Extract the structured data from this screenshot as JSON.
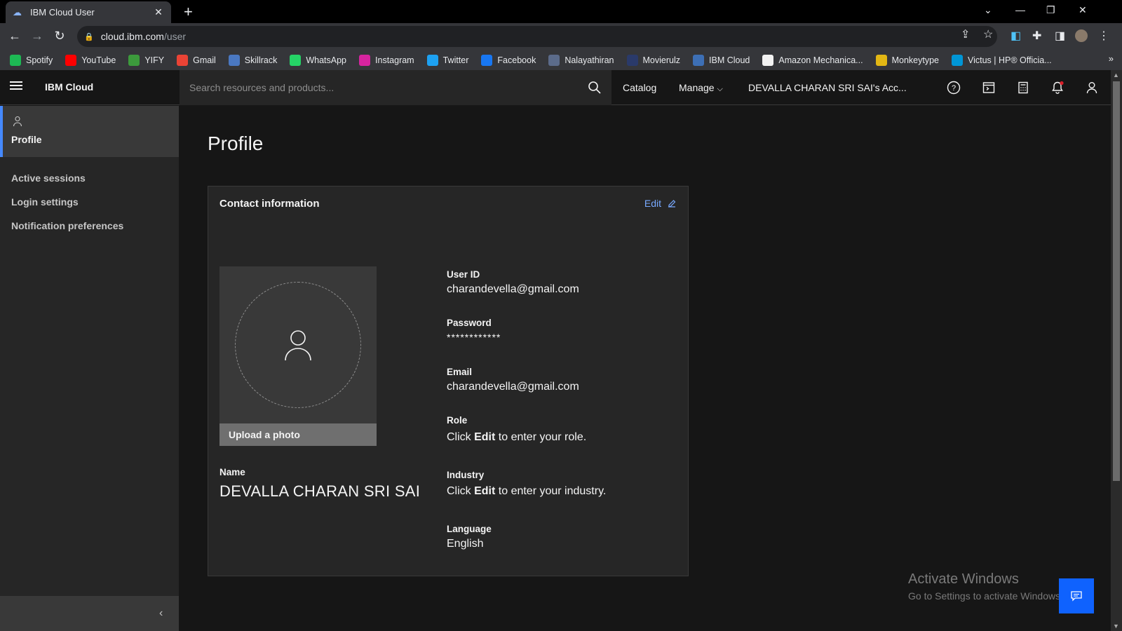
{
  "browser": {
    "tab_title": "IBM Cloud User",
    "url_host": "cloud.ibm.com",
    "url_path": "/user",
    "bookmarks": [
      {
        "label": "Spotify",
        "icon": "spotify-icon",
        "color": "#1db954"
      },
      {
        "label": "YouTube",
        "icon": "youtube-icon",
        "color": "#ff0000"
      },
      {
        "label": "YIFY",
        "icon": "yify-icon",
        "color": "#3c9a3c"
      },
      {
        "label": "Gmail",
        "icon": "gmail-icon",
        "color": "#ea4335"
      },
      {
        "label": "Skillrack",
        "icon": "skillrack-icon",
        "color": "#4a78c2"
      },
      {
        "label": "WhatsApp",
        "icon": "whatsapp-icon",
        "color": "#25d366"
      },
      {
        "label": "Instagram",
        "icon": "instagram-icon",
        "color": "#d6249f"
      },
      {
        "label": "Twitter",
        "icon": "twitter-icon",
        "color": "#1da1f2"
      },
      {
        "label": "Facebook",
        "icon": "facebook-icon",
        "color": "#1877f2"
      },
      {
        "label": "Nalayathiran",
        "icon": "nalayathiran-icon",
        "color": "#5b6b8a"
      },
      {
        "label": "Movierulz",
        "icon": "movierulz-icon",
        "color": "#2a3a6a"
      },
      {
        "label": "IBM Cloud",
        "icon": "ibm-cloud-icon",
        "color": "#3d6fb5"
      },
      {
        "label": "Amazon Mechanica...",
        "icon": "amazon-icon",
        "color": "#f2f2f2"
      },
      {
        "label": "Monkeytype",
        "icon": "monkeytype-icon",
        "color": "#e2b714"
      },
      {
        "label": "Victus | HP® Officia...",
        "icon": "hp-icon",
        "color": "#0096d6"
      }
    ]
  },
  "header": {
    "brand": "IBM Cloud",
    "search_placeholder": "Search resources and products...",
    "catalog": "Catalog",
    "manage": "Manage",
    "account": "DEVALLA CHARAN SRI SAI's Acc..."
  },
  "sidebar": {
    "active": "Profile",
    "items": [
      "Active sessions",
      "Login settings",
      "Notification preferences"
    ]
  },
  "main": {
    "title": "Profile",
    "card_title": "Contact information",
    "edit_label": "Edit",
    "upload_label": "Upload a photo",
    "name_label": "Name",
    "name_value": "DEVALLA CHARAN SRI SAI",
    "user_id_label": "User ID",
    "user_id_value": "charandevella@gmail.com",
    "password_label": "Password",
    "password_value": "************",
    "email_label": "Email",
    "email_value": "charandevella@gmail.com",
    "role_label": "Role",
    "role_prefix": "Click ",
    "role_bold": "Edit",
    "role_suffix": " to enter your role.",
    "industry_label": "Industry",
    "industry_prefix": "Click ",
    "industry_bold": "Edit",
    "industry_suffix": " to enter your industry.",
    "language_label": "Language",
    "language_value": "English"
  },
  "watermark": {
    "line1": "Activate Windows",
    "line2": "Go to Settings to activate Windows."
  }
}
